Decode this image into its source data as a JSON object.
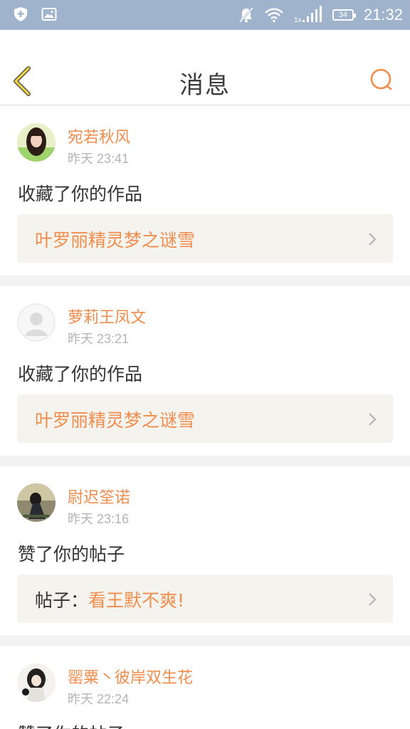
{
  "status_bar": {
    "time": "21:32",
    "battery": "34",
    "network_label": "1x"
  },
  "header": {
    "title": "消息"
  },
  "messages": [
    {
      "username": "宛若秋风",
      "time": "昨天 23:41",
      "action": "收藏了你的作品",
      "target": "叶罗丽精灵梦之谜雪",
      "target_prefix": "",
      "avatar": "avatar-girl-green"
    },
    {
      "username": "萝莉王凤文",
      "time": "昨天 23:21",
      "action": "收藏了你的作品",
      "target": "叶罗丽精灵梦之谜雪",
      "target_prefix": "",
      "avatar": "avatar-default"
    },
    {
      "username": "尉迟筌诺",
      "time": "昨天 23:16",
      "action": "赞了你的帖子",
      "target": "看王默不爽!",
      "target_prefix": "帖子：",
      "avatar": "avatar-dark-figure"
    },
    {
      "username": "罂粟丶彼岸双生花",
      "time": "昨天 22:24",
      "action": "赞了你的帖子",
      "target": "",
      "target_prefix": "",
      "avatar": "avatar-anime-girl"
    }
  ],
  "colors": {
    "accent": "#f08c4c",
    "status_bar": "#9fb3cc",
    "target_bg": "#f4f3ee"
  }
}
